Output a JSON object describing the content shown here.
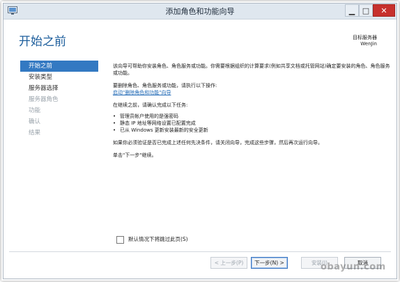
{
  "window": {
    "title": "添加角色和功能向导",
    "controls": {
      "minimize": "▁",
      "maximize": "□",
      "close": "✕"
    }
  },
  "header": {
    "page_title": "开始之前",
    "target_server_caption": "目标服务器",
    "target_server_name": "WenJin"
  },
  "sidebar": {
    "items": [
      {
        "label": "开始之前",
        "state": "active"
      },
      {
        "label": "安装类型",
        "state": "normal"
      },
      {
        "label": "服务器选择",
        "state": "normal"
      },
      {
        "label": "服务器角色",
        "state": "disabled"
      },
      {
        "label": "功能",
        "state": "disabled"
      },
      {
        "label": "确认",
        "state": "disabled"
      },
      {
        "label": "结果",
        "state": "disabled"
      }
    ]
  },
  "content": {
    "intro": "该向导可帮助你安装角色、角色服务或功能。你需要根据组织的计算要求(例如共享文档或托管网站)确定要安装的角色、角色服务或功能。",
    "remove_prompt": "要删除角色、角色服务或功能，请执行以下操作:",
    "remove_link": "启动\"删除角色和功能\"向导",
    "before_continue": "在继续之前，请确认完成以下任务:",
    "tasks": [
      "管理员帐户使用的是强密码",
      "静态 IP 地址等网络设置已配置完成",
      "已从 Windows 更新安装最新的安全更新"
    ],
    "verify_note": "如果你必须验证是否已完成上述任何先决条件，请关闭向导，完成这些步骤，然后再次运行向导。",
    "continue_note": "单击\"下一步\"继续。"
  },
  "skip_checkbox": {
    "label": "默认情况下将跳过此页(S)",
    "checked": false
  },
  "footer": {
    "prev": "< 上一步(P)",
    "next": "下一步(N) >",
    "install": "安装(I)",
    "cancel": "取消"
  },
  "watermark": "obayun.com",
  "colors": {
    "accent": "#3379c2",
    "heading": "#1d5e9c",
    "link": "#1f68b5",
    "close_button": "#c7312d"
  }
}
